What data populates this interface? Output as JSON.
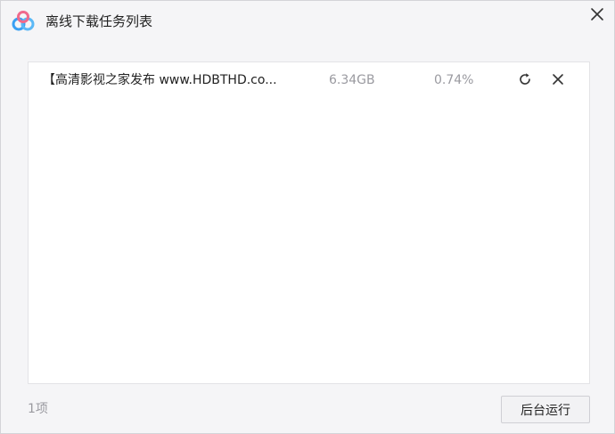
{
  "window": {
    "title": "离线下载任务列表",
    "logo_icon": "baidu-netdisk-logo-icon",
    "close_icon": "close-icon"
  },
  "tasks": [
    {
      "name": "【高清影视之家发布 www.HDBTHD.co...",
      "size": "6.34GB",
      "progress": "0.74%",
      "progress_value": 0.74,
      "retry_icon": "refresh-icon",
      "delete_icon": "close-icon"
    }
  ],
  "footer": {
    "count": "1项",
    "background_button": "后台运行"
  },
  "colors": {
    "background": "#f5f5f7",
    "panel": "#ffffff",
    "text": "#222222",
    "muted": "#9a9aa0",
    "logo_blue": "#3aa0f3",
    "logo_pink": "#f06a8c"
  }
}
